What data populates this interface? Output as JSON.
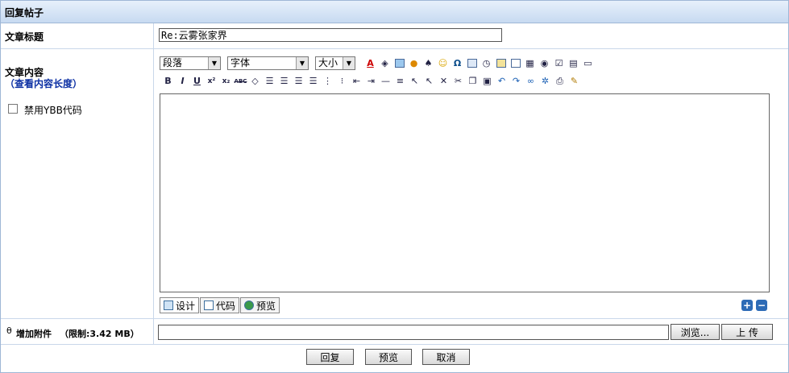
{
  "panel": {
    "title": "回复帖子"
  },
  "fields": {
    "title_label": "文章标题",
    "title_value": "Re:云雾张家界",
    "content_label": "文章内容",
    "check_length_link": "查看内容长度",
    "check_length_open": "（",
    "check_length_close": "）",
    "disable_ybb_label": "禁用YBB代码"
  },
  "toolbar": {
    "paragraph_select": "段落",
    "font_select": "字体",
    "size_select": "大小",
    "bold": "B",
    "italic": "I",
    "underline": "U",
    "superscript": "x²",
    "subscript": "x₂",
    "strike": "ABC",
    "special_char": "Ω"
  },
  "editor_tabs": {
    "design": "设计",
    "code": "代码",
    "preview": "预览"
  },
  "attachment": {
    "label": "增加附件",
    "limit": "（限制:3.42 MB）",
    "browse_button": "浏览...",
    "upload_button": "上 传"
  },
  "actions": {
    "reply": "回复",
    "preview": "预览",
    "cancel": "取消"
  }
}
